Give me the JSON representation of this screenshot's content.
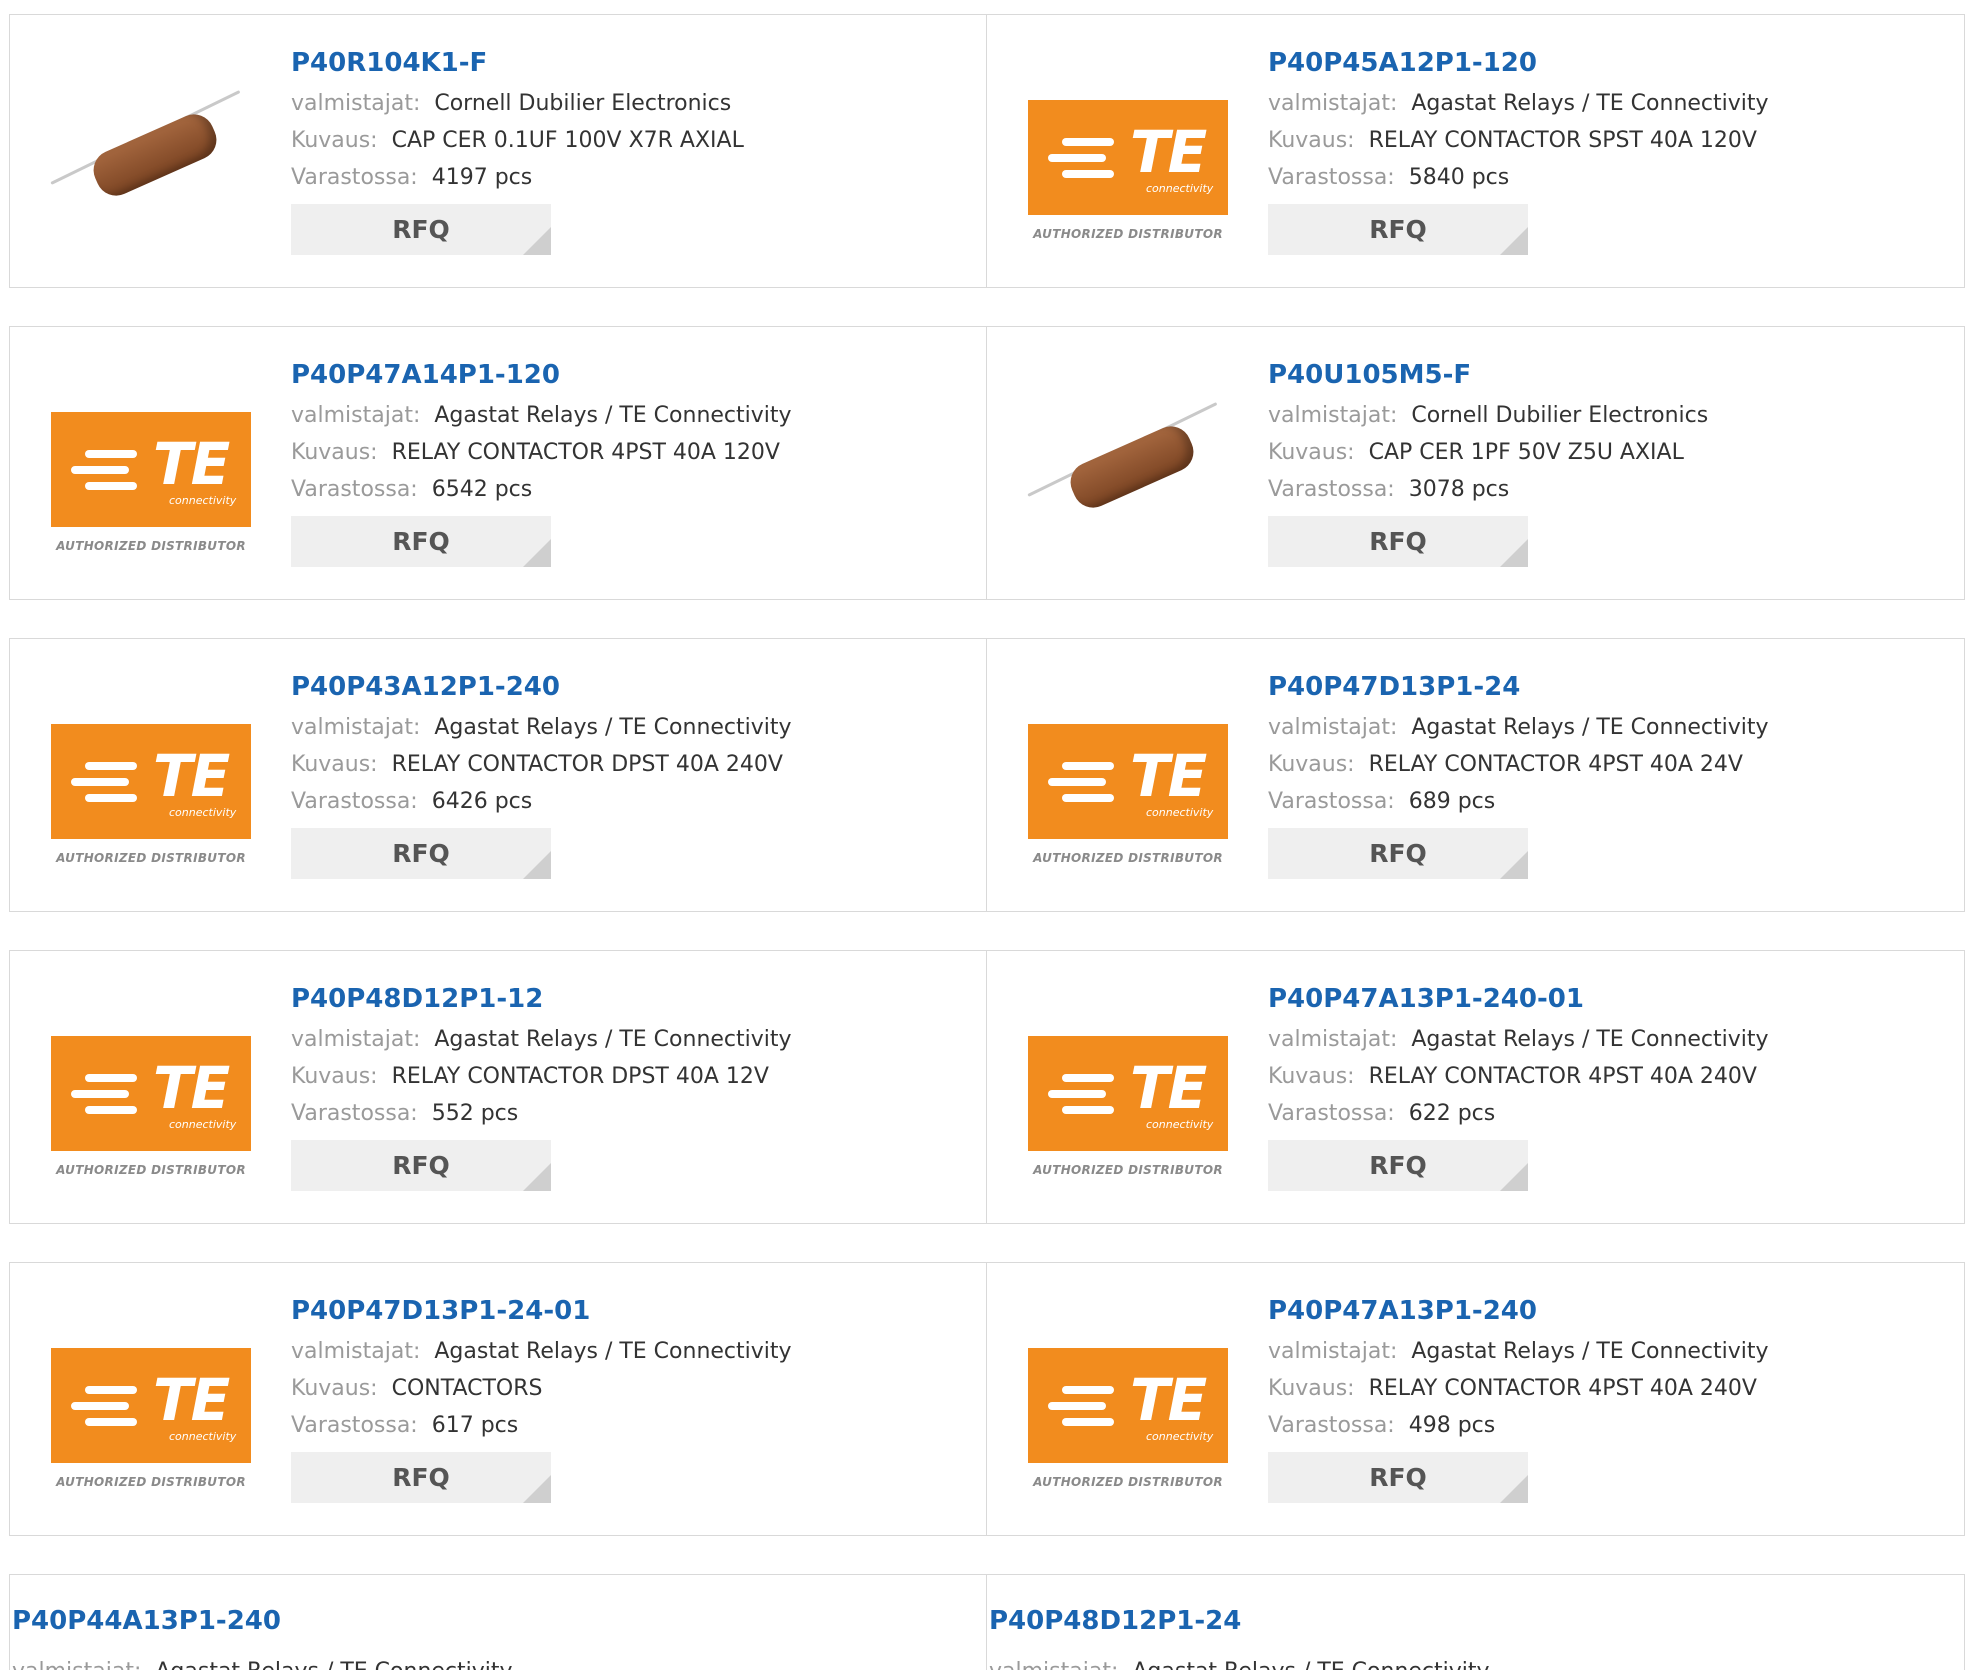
{
  "labels": {
    "manufacturer": "valmistajat:",
    "description": "Kuvaus:",
    "stock": "Varastossa:",
    "rfq": "RFQ",
    "te_letters": "TE",
    "te_sub": "connectivity",
    "te_authorized": "AUTHORIZED DISTRIBUTOR"
  },
  "products": [
    {
      "part": "P40R104K1-F",
      "manufacturer": "Cornell Dubilier Electronics",
      "description": "CAP CER 0.1UF 100V X7R AXIAL",
      "stock": "4197 pcs",
      "image": "capacitor"
    },
    {
      "part": "P40P45A12P1-120",
      "manufacturer": "Agastat Relays / TE Connectivity",
      "description": "RELAY CONTACTOR SPST 40A 120V",
      "stock": "5840 pcs",
      "image": "te-logo"
    },
    {
      "part": "P40P47A14P1-120",
      "manufacturer": "Agastat Relays / TE Connectivity",
      "description": "RELAY CONTACTOR 4PST 40A 120V",
      "stock": "6542 pcs",
      "image": "te-logo"
    },
    {
      "part": "P40U105M5-F",
      "manufacturer": "Cornell Dubilier Electronics",
      "description": "CAP CER 1PF 50V Z5U AXIAL",
      "stock": "3078 pcs",
      "image": "capacitor"
    },
    {
      "part": "P40P43A12P1-240",
      "manufacturer": "Agastat Relays / TE Connectivity",
      "description": "RELAY CONTACTOR DPST 40A 240V",
      "stock": "6426 pcs",
      "image": "te-logo"
    },
    {
      "part": "P40P47D13P1-24",
      "manufacturer": "Agastat Relays / TE Connectivity",
      "description": "RELAY CONTACTOR 4PST 40A 24V",
      "stock": "689 pcs",
      "image": "te-logo"
    },
    {
      "part": "P40P48D12P1-12",
      "manufacturer": "Agastat Relays / TE Connectivity",
      "description": "RELAY CONTACTOR DPST 40A 12V",
      "stock": "552 pcs",
      "image": "te-logo"
    },
    {
      "part": "P40P47A13P1-240-01",
      "manufacturer": "Agastat Relays / TE Connectivity",
      "description": "RELAY CONTACTOR 4PST 40A 240V",
      "stock": "622 pcs",
      "image": "te-logo"
    },
    {
      "part": "P40P47D13P1-24-01",
      "manufacturer": "Agastat Relays / TE Connectivity",
      "description": "CONTACTORS",
      "stock": "617 pcs",
      "image": "te-logo"
    },
    {
      "part": "P40P47A13P1-240",
      "manufacturer": "Agastat Relays / TE Connectivity",
      "description": "RELAY CONTACTOR 4PST 40A 240V",
      "stock": "498 pcs",
      "image": "te-logo"
    }
  ],
  "partial_products": [
    {
      "part": "P40P44A13P1-240",
      "manufacturer": "Agastat Relays / TE Connectivity"
    },
    {
      "part": "P40P48D12P1-24",
      "manufacturer": "Agastat Relays / TE Connectivity"
    }
  ],
  "colors": {
    "link": "#1a64b0",
    "te_orange": "#f28c1e",
    "label_gray": "#9a9a9a",
    "button_bg": "#efefef"
  }
}
